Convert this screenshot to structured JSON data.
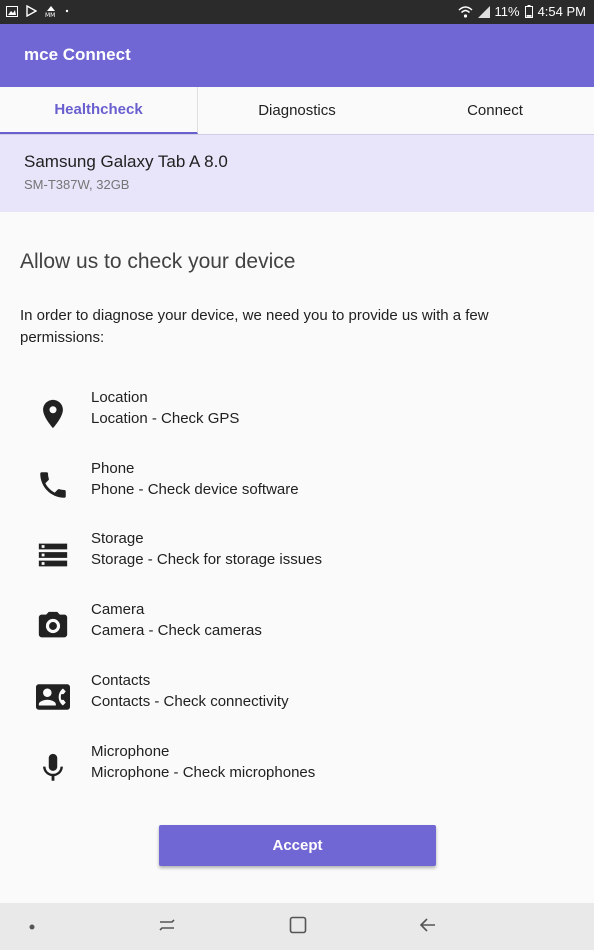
{
  "status_bar": {
    "battery_percent": "11%",
    "time": "4:54 PM",
    "notification_icons": [
      "image-icon",
      "play-store-icon",
      "mm-icon",
      "dot-icon"
    ]
  },
  "app_bar": {
    "title": "mce Connect"
  },
  "tabs": [
    {
      "label": "Healthcheck",
      "active": true
    },
    {
      "label": "Diagnostics",
      "active": false
    },
    {
      "label": "Connect",
      "active": false
    }
  ],
  "device": {
    "name": "Samsung Galaxy Tab A 8.0",
    "details": "SM-T387W, 32GB"
  },
  "content": {
    "heading": "Allow us to check your device",
    "intro": "In order to diagnose your device, we need you to provide us with a few permissions:"
  },
  "permissions": [
    {
      "icon": "location-icon",
      "title": "Location",
      "description": "Location - Check GPS"
    },
    {
      "icon": "phone-icon",
      "title": "Phone",
      "description": "Phone - Check device software"
    },
    {
      "icon": "storage-icon",
      "title": "Storage",
      "description": "Storage - Check for storage issues"
    },
    {
      "icon": "camera-icon",
      "title": "Camera",
      "description": "Camera - Check cameras"
    },
    {
      "icon": "contacts-icon",
      "title": "Contacts",
      "description": "Contacts - Check connectivity"
    },
    {
      "icon": "microphone-icon",
      "title": "Microphone",
      "description": "Microphone - Check microphones"
    }
  ],
  "accept_label": "Accept",
  "colors": {
    "primary": "#7167d4",
    "device_card": "#e8e5fa",
    "tab_active": "#6a5fcf"
  }
}
